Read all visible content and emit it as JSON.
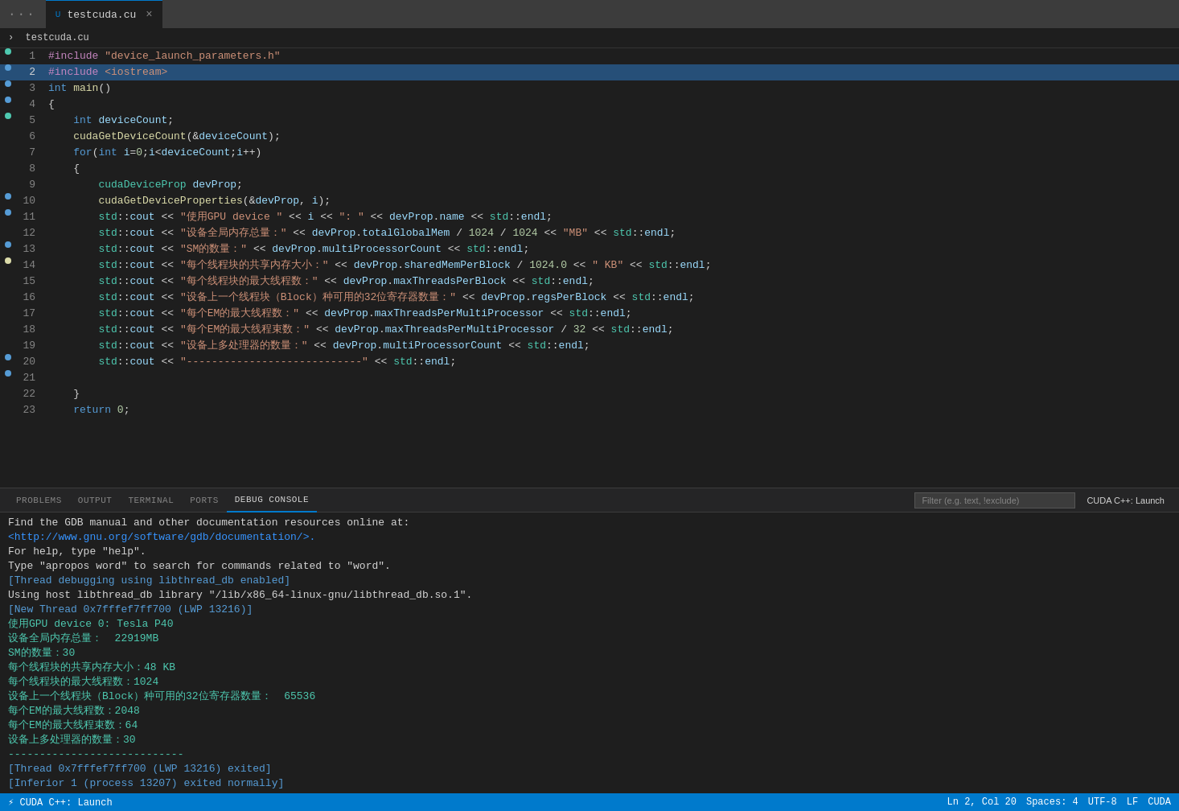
{
  "titlebar": {
    "dots": "···",
    "tab_name": "testcuda.cu",
    "tab_modified": "U",
    "tab_close": "×"
  },
  "breadcrumb": {
    "separator": ">",
    "file": "testcuda.cu"
  },
  "code": {
    "lines": [
      {
        "num": 1,
        "indicator": "dot",
        "content": "#include \"device_launch_parameters.h\""
      },
      {
        "num": 2,
        "indicator": "dot-u",
        "content": "#include <iostream>"
      },
      {
        "num": 3,
        "indicator": "dot-u",
        "content": "int main()"
      },
      {
        "num": 4,
        "indicator": "dot-u",
        "content": "{"
      },
      {
        "num": 5,
        "indicator": "dot",
        "content": "    int deviceCount;"
      },
      {
        "num": 6,
        "indicator": "",
        "content": "    cudaGetDeviceCount(&deviceCount);"
      },
      {
        "num": 7,
        "indicator": "",
        "content": "    for(int i=0;i<deviceCount;i++)"
      },
      {
        "num": 8,
        "indicator": "",
        "content": "    {"
      },
      {
        "num": 9,
        "indicator": "",
        "content": "        cudaDeviceProp devProp;"
      },
      {
        "num": 10,
        "indicator": "dot-u",
        "content": "        cudaGetDeviceProperties(&devProp, i);"
      },
      {
        "num": 11,
        "indicator": "dot-u",
        "content": "        std::cout << \"使用GPU device \" << i << \": \" << devProp.name << std::endl;"
      },
      {
        "num": 12,
        "indicator": "",
        "content": "        std::cout << \"设备全局内存总量：\" << devProp.totalGlobalMem / 1024 / 1024 << \"MB\" << std::endl;"
      },
      {
        "num": 13,
        "indicator": "dot-u",
        "content": "        std::cout << \"SM的数量：\" << devProp.multiProcessorCount << std::endl;"
      },
      {
        "num": 14,
        "indicator": "dot-m",
        "content": "        std::cout << \"每个线程块的共享内存大小：\" << devProp.sharedMemPerBlock / 1024.0 << \" KB\" << std::endl;"
      },
      {
        "num": 15,
        "indicator": "",
        "content": "        std::cout << \"每个线程块的最大线程数：\" << devProp.maxThreadsPerBlock << std::endl;"
      },
      {
        "num": 16,
        "indicator": "",
        "content": "        std::cout << \"设备上一个线程块（Block）种可用的32位寄存器数量：\" << devProp.regsPerBlock << std::endl;"
      },
      {
        "num": 17,
        "indicator": "",
        "content": "        std::cout << \"每个EM的最大线程数：\" << devProp.maxThreadsPerMultiProcessor << std::endl;"
      },
      {
        "num": 18,
        "indicator": "",
        "content": "        std::cout << \"每个EM的最大线程束数：\" << devProp.maxThreadsPerMultiProcessor / 32 << std::endl;"
      },
      {
        "num": 19,
        "indicator": "",
        "content": "        std::cout << \"设备上多处理器的数量：\" << devProp.multiProcessorCount << std::endl;"
      },
      {
        "num": 20,
        "indicator": "dot-u",
        "content": "        std::cout << \"----------------------------\" << std::endl;"
      },
      {
        "num": 21,
        "indicator": "dot-u",
        "content": ""
      },
      {
        "num": 22,
        "indicator": "",
        "content": "    }"
      },
      {
        "num": 23,
        "indicator": "",
        "content": "    return 0;"
      }
    ]
  },
  "panel": {
    "tabs": [
      {
        "id": "problems",
        "label": "PROBLEMS"
      },
      {
        "id": "output",
        "label": "OUTPUT"
      },
      {
        "id": "terminal",
        "label": "TERMINAL"
      },
      {
        "id": "ports",
        "label": "PORTS"
      },
      {
        "id": "debug-console",
        "label": "DEBUG CONSOLE",
        "active": true
      }
    ],
    "filter_placeholder": "Filter (e.g. text, !exclude)",
    "launch_label": "CUDA C++: Launch"
  },
  "debug_output": [
    {
      "type": "default",
      "text": "Find the GDB manual and other documentation resources online at:"
    },
    {
      "type": "url",
      "text": "<http://www.gnu.org/software/gdb/documentation/>."
    },
    {
      "type": "default",
      "text": "For help, type \"help\"."
    },
    {
      "type": "default",
      "text": "Type \"apropos word\" to search for commands related to \"word\"."
    },
    {
      "type": "thread",
      "text": "[Thread debugging using libthread_db enabled]"
    },
    {
      "type": "default",
      "text": "Using host libthread_db library \"/lib/x86_64-linux-gnu/libthread_db.so.1\"."
    },
    {
      "type": "thread",
      "text": "[New Thread 0x7fffef7ff700 (LWP 13216)]"
    },
    {
      "type": "gpu",
      "text": "使用GPU device 0: Tesla P40"
    },
    {
      "type": "gpu",
      "text": "设备全局内存总量：  22919MB"
    },
    {
      "type": "gpu",
      "text": "SM的数量：30"
    },
    {
      "type": "gpu",
      "text": "每个线程块的共享内存大小：48 KB"
    },
    {
      "type": "gpu",
      "text": "每个线程块的最大线程数：1024"
    },
    {
      "type": "gpu",
      "text": "设备上一个线程块（Block）种可用的32位寄存器数量：  65536"
    },
    {
      "type": "gpu",
      "text": "每个EM的最大线程数：2048"
    },
    {
      "type": "gpu",
      "text": "每个EM的最大线程束数：64"
    },
    {
      "type": "gpu",
      "text": "设备上多处理器的数量：30"
    },
    {
      "type": "gpu",
      "text": "----------------------------"
    },
    {
      "type": "thread",
      "text": "[Thread 0x7fffef7ff700 (LWP 13216) exited]"
    },
    {
      "type": "thread",
      "text": "[Inferior 1 (process 13207) exited normally]"
    }
  ],
  "statusbar": {
    "left": {
      "debug": "⚡ CUDA C++: Launch"
    },
    "right": {
      "position": "Ln 2, Col 20",
      "spaces": "Spaces: 4",
      "encoding": "UTF-8",
      "line_ending": "LF",
      "language": "CUDA"
    }
  }
}
